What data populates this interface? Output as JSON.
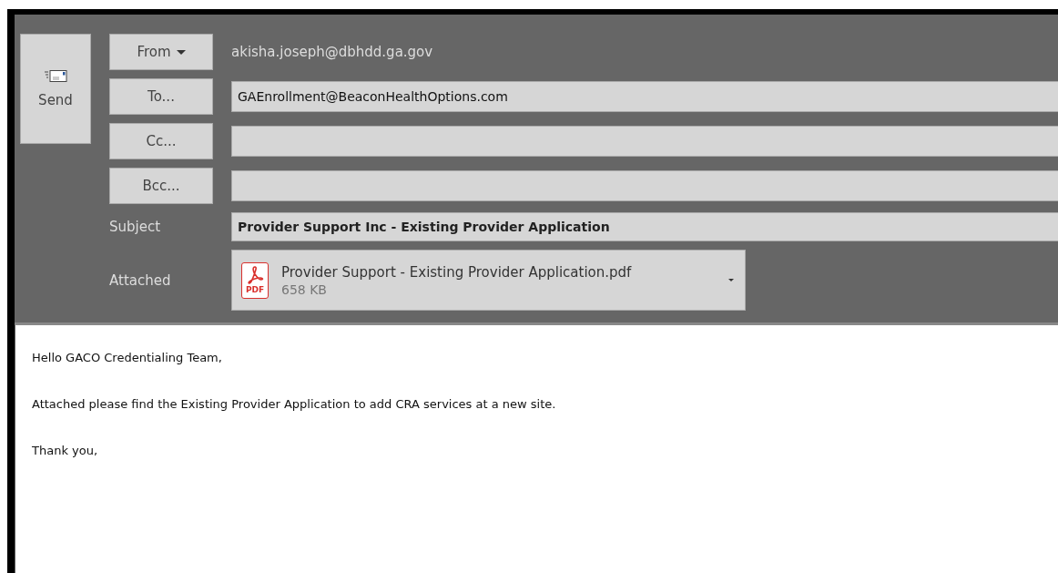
{
  "send_button": {
    "label": "Send"
  },
  "from": {
    "label": "From",
    "value": "akisha.joseph@dbhdd.ga.gov"
  },
  "recipients": [
    {
      "label": "To...",
      "value": "GAEnrollment@BeaconHealthOptions.com"
    },
    {
      "label": "Cc..."
    },
    {
      "label": "Bcc..."
    }
  ],
  "subject": {
    "label": "Subject",
    "value": "Provider Support Inc - Existing Provider Application"
  },
  "attached": {
    "label": "Attached",
    "icon_label": "PDF",
    "file_name": "Provider Support - Existing Provider Application.pdf",
    "size": "658 KB"
  },
  "body": [
    "Hello GACO Credentialing Team,",
    "Attached please find the Existing Provider Application to add CRA services at a new site.",
    "Thank you,"
  ]
}
